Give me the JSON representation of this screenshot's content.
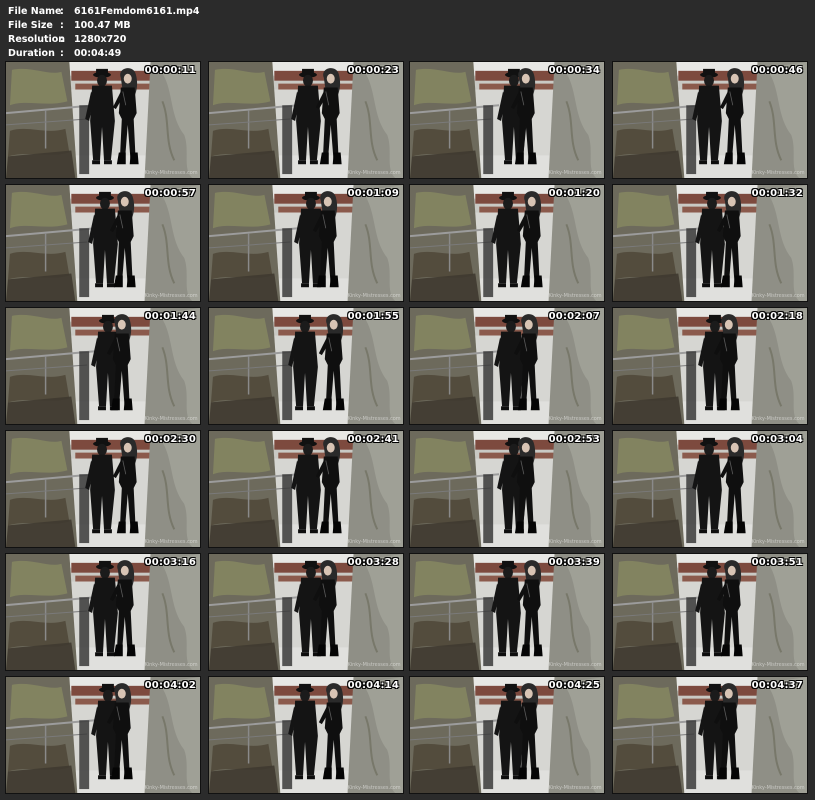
{
  "info": {
    "file_name_label": "File Name",
    "file_name": "6161Femdom6161.mp4",
    "file_size_label": "File Size",
    "file_size": "100.47 MB",
    "resolution_label": "Resolution",
    "resolution": "1280x720",
    "duration_label": "Duration",
    "duration": "00:04:49",
    "separator": ":"
  },
  "thumbnails": [
    {
      "timestamp": "00:00:11"
    },
    {
      "timestamp": "00:00:23"
    },
    {
      "timestamp": "00:00:34"
    },
    {
      "timestamp": "00:00:46"
    },
    {
      "timestamp": "00:00:57"
    },
    {
      "timestamp": "00:01:09"
    },
    {
      "timestamp": "00:01:20"
    },
    {
      "timestamp": "00:01:32"
    },
    {
      "timestamp": "00:01:44"
    },
    {
      "timestamp": "00:01:55"
    },
    {
      "timestamp": "00:02:07"
    },
    {
      "timestamp": "00:02:18"
    },
    {
      "timestamp": "00:02:30"
    },
    {
      "timestamp": "00:02:41"
    },
    {
      "timestamp": "00:02:53"
    },
    {
      "timestamp": "00:03:04"
    },
    {
      "timestamp": "00:03:16"
    },
    {
      "timestamp": "00:03:28"
    },
    {
      "timestamp": "00:03:39"
    },
    {
      "timestamp": "00:03:51"
    },
    {
      "timestamp": "00:04:02"
    },
    {
      "timestamp": "00:04:14"
    },
    {
      "timestamp": "00:04:25"
    },
    {
      "timestamp": "00:04:37"
    }
  ]
}
